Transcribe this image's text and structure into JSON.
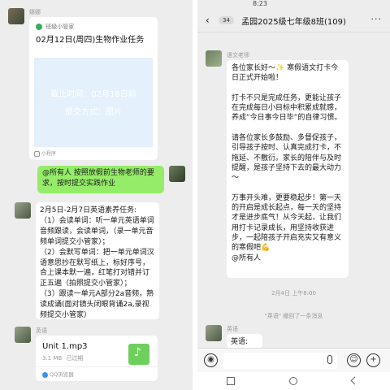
{
  "left": {
    "msg1": {
      "sender": "娜娜",
      "card_header": "班级小管家",
      "card_title": "02月12日(周四)生物作业任务",
      "deadline": "截止时间：02月16日前",
      "submit_mode": "提交方式：图片",
      "mini_program": "小程序"
    },
    "msg2": {
      "text": "@所有人  按照放假前生物老师的要求，按时提交实践作业"
    },
    "msg3": {
      "text": "2月5日-2月7日英语素养任务:\n（1）会读单词：听一单元英语单词音频跟读，会读单词，（录一单元音频单词提交小管家）；\n（2）会默写单词：把一单元单词汉语意思抄在默写纸上，标好序号，合上课本默一遍，红笔打对错并订正五遍（拍照提交小管家）；\n（3）跟读一单元A部分2a音频，熟读成诵(面对镜头闭眼背诵2a,录视频提交小管家）"
    },
    "msg4": {
      "sender": "英语",
      "file_name": "Unit 1.mp3",
      "file_size": "3.1 MB",
      "file_status": "已过期",
      "source": "QQ浏览器"
    }
  },
  "right": {
    "status_time": "8:23",
    "unread_count": "34",
    "chat_title": "孟园2025级七年级8班(109)",
    "msg1": {
      "sender": "语文老师",
      "text": "各位家长好～✨ 寒假语文打卡今日正式开始啦！\n\n打卡不只是完成任务，更能让孩子在完成每日小目标中积累成就感，养成“今日事今日毕”的自律习惯。\n\n请各位家长多鼓励、多督促孩子，引导孩子按时、认真完成打卡，不拖延、不敷衍。家长的陪伴与及时提醒，是孩子坚持下去的最大动力～\n\n万事开头难，更要稳起步！第一天的开启是成长起点，每一天的坚持才是进步底气！从今天起，让我们用打卡记录成长，用坚持收获进步，一起陪孩子开启充实又有意义的寒假吧💪\n@所有人"
    },
    "timestamp": "2月4日 上午8:00",
    "recall_notice": "\"英语\" 撤回了一条消息",
    "msg2": {
      "sender": "英语",
      "text": "英语:"
    }
  }
}
